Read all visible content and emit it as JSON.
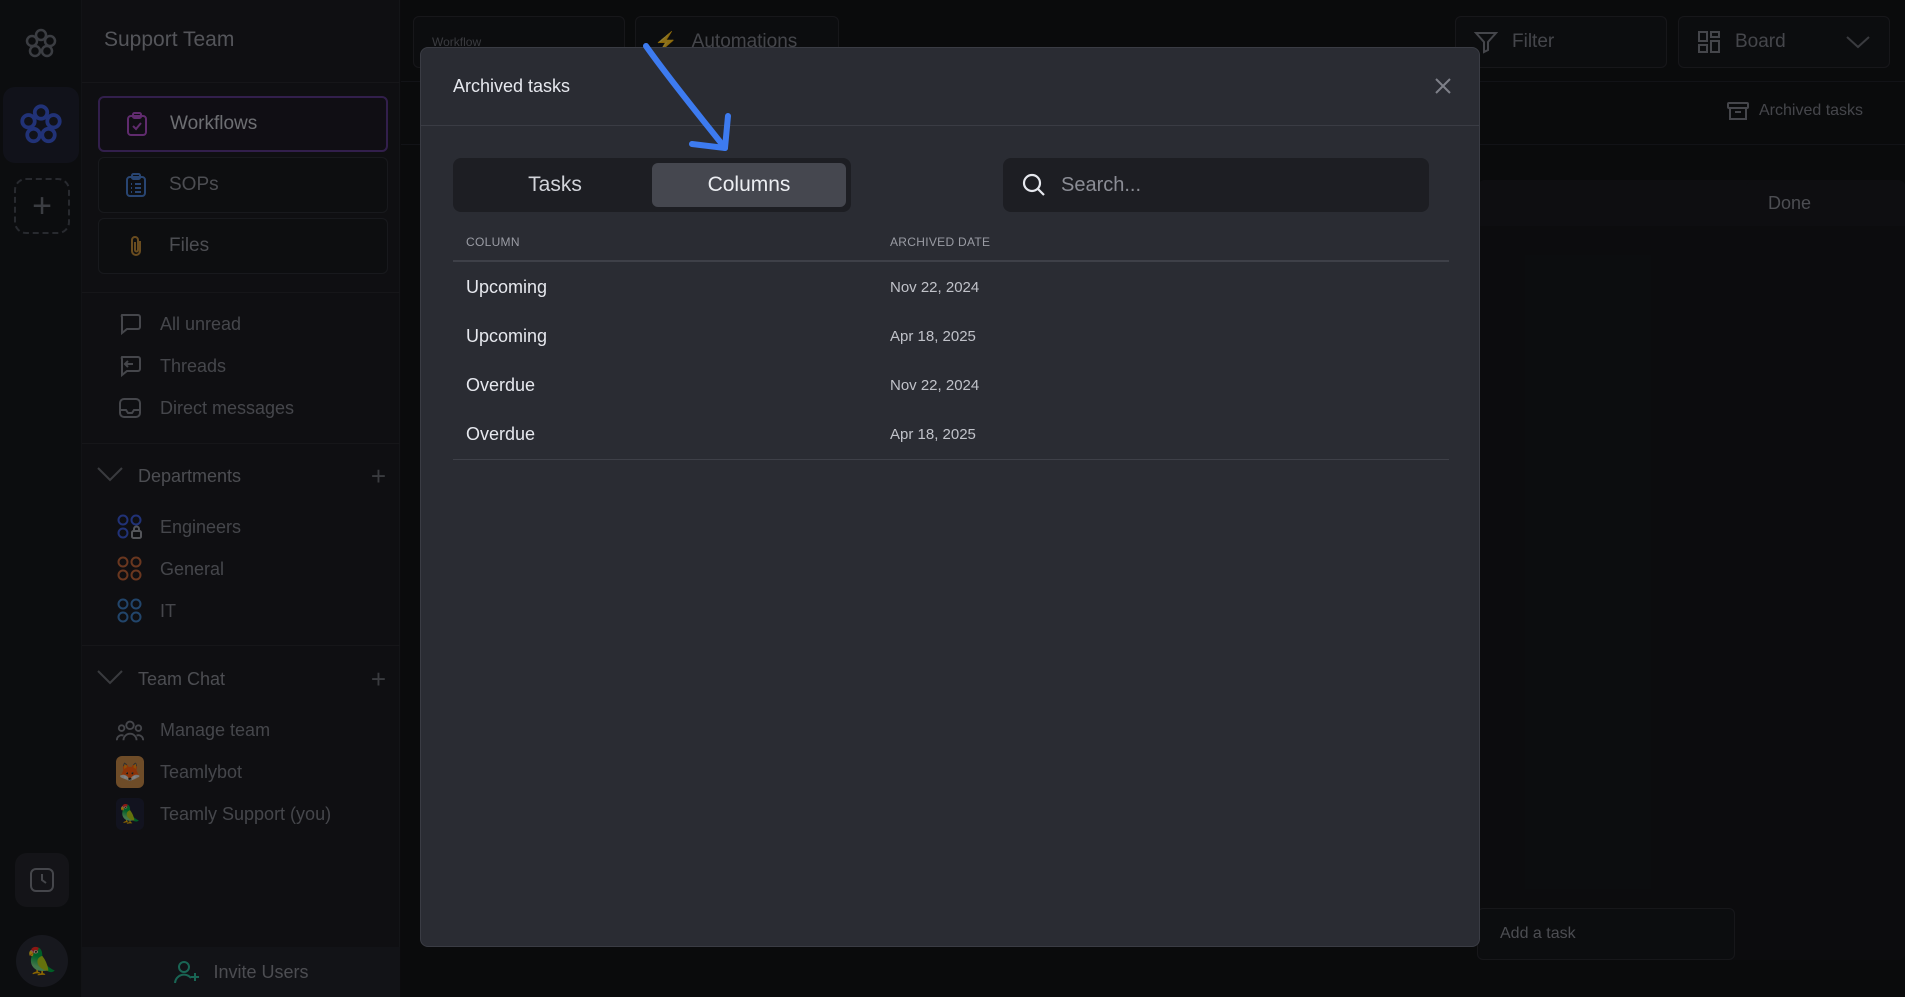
{
  "sidebar": {
    "team_name": "Support Team",
    "nav": [
      {
        "label": "Workflows"
      },
      {
        "label": "SOPs"
      },
      {
        "label": "Files"
      }
    ],
    "inbox": [
      {
        "label": "All unread"
      },
      {
        "label": "Threads"
      },
      {
        "label": "Direct messages"
      }
    ],
    "departments": {
      "title": "Departments",
      "items": [
        {
          "label": "Engineers"
        },
        {
          "label": "General"
        },
        {
          "label": "IT"
        }
      ]
    },
    "team_chat": {
      "title": "Team Chat",
      "items": [
        {
          "label": "Manage team"
        },
        {
          "label": "Teamlybot"
        },
        {
          "label": "Teamly Support (you)"
        }
      ]
    },
    "invite_label": "Invite Users"
  },
  "topbar": {
    "workflow_caption": "Workflow",
    "automations_label": "Automations",
    "filter_label": "Filter",
    "board_label": "Board"
  },
  "subbar": {
    "archived_label": "Archived tasks"
  },
  "board": {
    "done_label": "Done",
    "add_task_label": "Add a task"
  },
  "modal": {
    "title": "Archived tasks",
    "tabs": [
      {
        "label": "Tasks"
      },
      {
        "label": "Columns"
      }
    ],
    "active_tab": "Columns",
    "search_placeholder": "Search...",
    "columns": {
      "column": "COLUMN",
      "archived_date": "ARCHIVED DATE"
    },
    "rows": [
      {
        "column": "Upcoming",
        "date": "Nov 22, 2024"
      },
      {
        "column": "Upcoming",
        "date": "Apr 18, 2025"
      },
      {
        "column": "Overdue",
        "date": "Nov 22, 2024"
      },
      {
        "column": "Overdue",
        "date": "Apr 18, 2025"
      }
    ]
  },
  "colors": {
    "accent_purple": "#5b3a8a",
    "annotation_arrow": "#3d7bf0",
    "modal_bg": "#2a2c33"
  }
}
